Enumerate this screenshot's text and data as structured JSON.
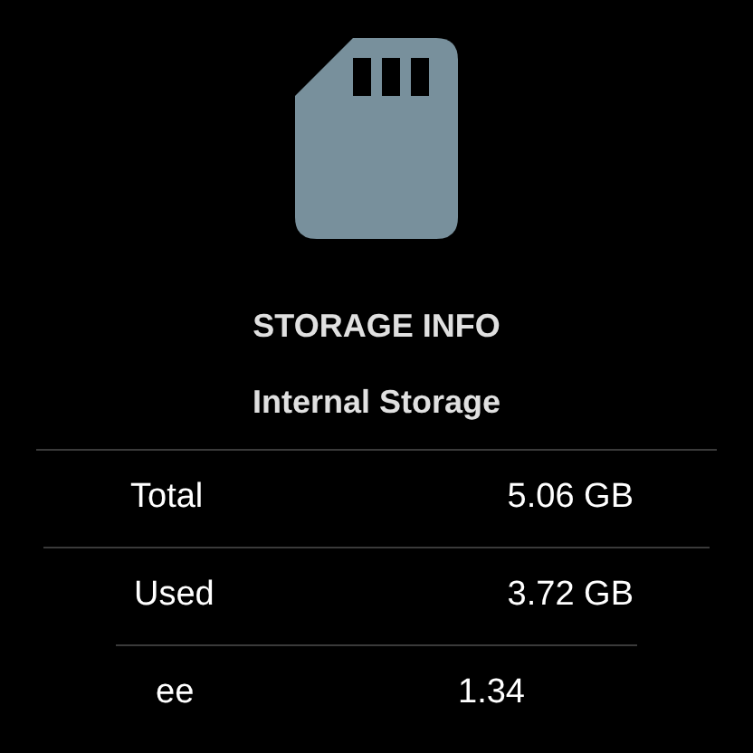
{
  "title": "STORAGE INFO",
  "subtitle": "Internal Storage",
  "rows": [
    {
      "label": "Total",
      "value": "5.06 GB"
    },
    {
      "label": "Used",
      "value": "3.72 GB"
    },
    {
      "label": "ee",
      "value": "1.34"
    }
  ]
}
